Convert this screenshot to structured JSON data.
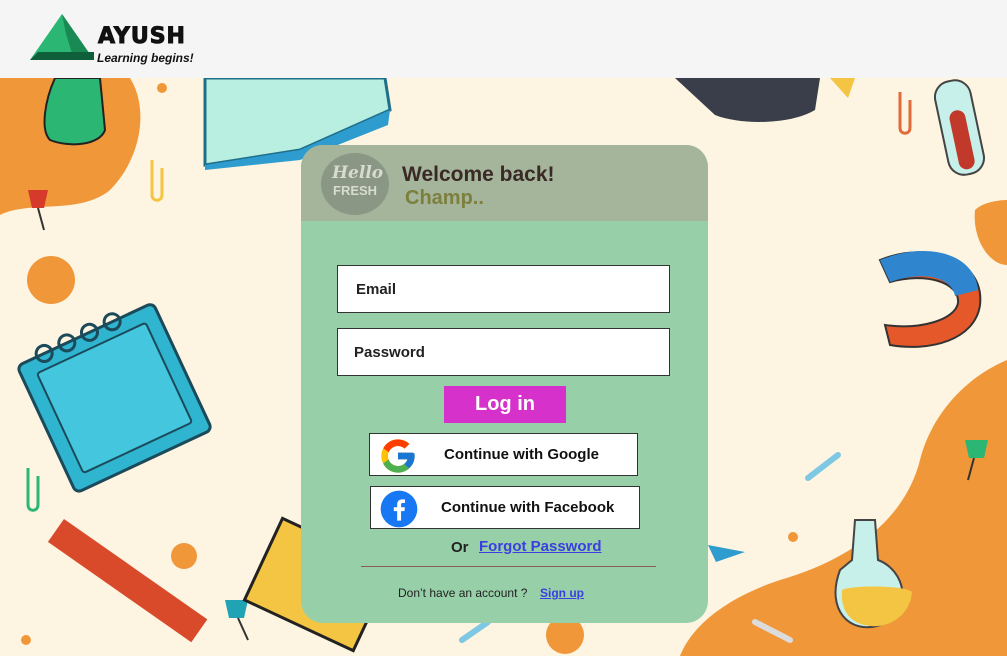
{
  "brand": {
    "name": "AYUSH",
    "tagline": "Learning begins!"
  },
  "card": {
    "badge_line1": "Hello",
    "badge_line2": "FRESH",
    "welcome": "Welcome back!",
    "subtitle": "Champ..",
    "email_placeholder": "Email",
    "password_placeholder": "Password",
    "login_label": "Log in",
    "google_label": "Continue with Google",
    "facebook_label": "Continue with Facebook",
    "or_label": "Or",
    "forgot_label": "Forgot Password",
    "no_account_label": "Don’t have an account ?",
    "signup_label": "Sign up"
  },
  "colors": {
    "card_bg": "#97cfa8",
    "card_header": "#a4b59c",
    "login_button": "#d631cb",
    "link": "#3b3fe0",
    "background": "#fdf4e1",
    "accent_orange": "#f0973a"
  },
  "icons": {
    "logo": "mountain-logo-icon",
    "google": "google-icon",
    "facebook": "facebook-icon"
  }
}
